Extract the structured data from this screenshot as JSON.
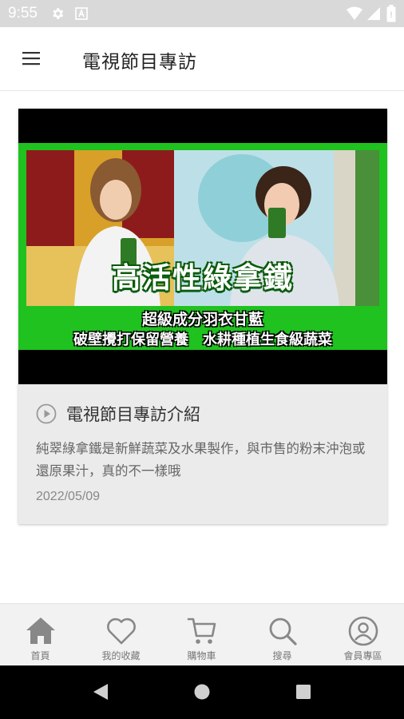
{
  "status_bar": {
    "time": "9:55",
    "icons": [
      "gear-icon",
      "a-icon",
      "wifi-icon",
      "signal-icon",
      "battery-icon"
    ]
  },
  "app_bar": {
    "title": "電視節目專訪",
    "menu_icon": "hamburger-menu-icon"
  },
  "card": {
    "video": {
      "banner_main": "高活性綠拿鐵",
      "banner_sub1": "超級成分羽衣甘藍",
      "banner_sub2": "破壁攪打保留營養　水耕種植生食級蔬菜"
    },
    "title": "電視節目專訪介紹",
    "description": "純翠綠拿鐵是新鮮蔬菜及水果製作，與市售的粉末沖泡或還原果汁，真的不一樣哦",
    "date": "2022/05/09"
  },
  "bottom_nav": {
    "items": [
      {
        "label": "首頁",
        "icon": "home-icon"
      },
      {
        "label": "我的收藏",
        "icon": "heart-icon"
      },
      {
        "label": "購物車",
        "icon": "cart-icon"
      },
      {
        "label": "搜尋",
        "icon": "search-icon"
      },
      {
        "label": "會員專區",
        "icon": "user-icon"
      }
    ]
  },
  "colors": {
    "accent_green": "#1fc21f",
    "nav_icon": "#888888",
    "status_bar_bg": "#d9d9d9"
  }
}
